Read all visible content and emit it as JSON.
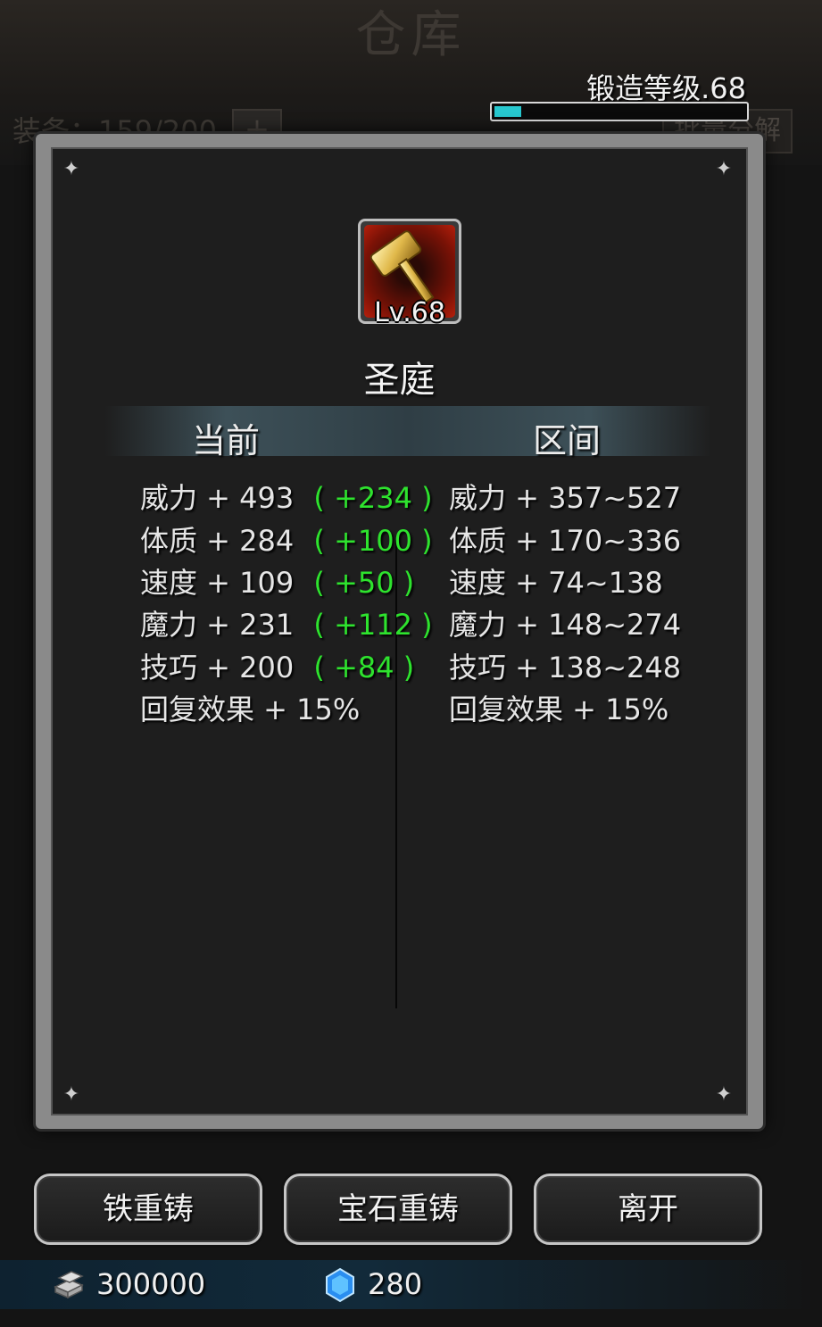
{
  "background": {
    "title": "仓库",
    "storage_label": "装备：159/200",
    "add_button": "+",
    "batch_button": "批量分解"
  },
  "forge": {
    "label": "锻造等级.68",
    "progress": 0.11
  },
  "item": {
    "icon": "golden-hammer-icon",
    "level": "Lv.68",
    "name": "圣庭"
  },
  "columns": {
    "current": "当前",
    "range": "区间"
  },
  "stats": {
    "current": [
      {
        "label": "威力 + 493",
        "bonus": "( +234 )"
      },
      {
        "label": "体质 + 284",
        "bonus": "( +100 )"
      },
      {
        "label": "速度 + 109",
        "bonus": "( +50 )"
      },
      {
        "label": "魔力 + 231",
        "bonus": "( +112 )"
      },
      {
        "label": "技巧 + 200",
        "bonus": "( +84 )"
      },
      {
        "label": "回复效果 + 15%",
        "bonus": ""
      }
    ],
    "range": [
      "威力 + 357~527",
      "体质 + 170~336",
      "速度 + 74~138",
      "魔力 + 148~274",
      "技巧 + 138~248",
      "回复效果 + 15%"
    ]
  },
  "buttons": {
    "iron_reforge": "铁重铸",
    "gem_reforge": "宝石重铸",
    "leave": "离开"
  },
  "currency": {
    "iron": "300000",
    "gem": "280",
    "iron_icon": "iron-ingot-icon",
    "gem_icon": "blue-gem-icon"
  },
  "colors": {
    "bonus": "#2ee32e",
    "forge_bar": "#27c8cf"
  }
}
